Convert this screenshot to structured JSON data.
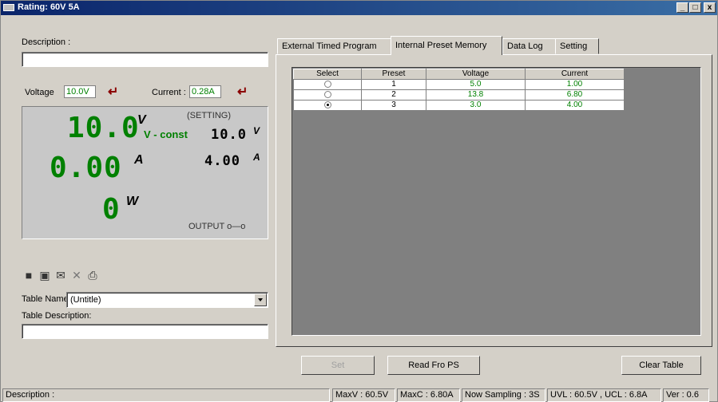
{
  "window": {
    "title": "Rating: 60V 5A",
    "minimize": "_",
    "maximize": "□",
    "close": "x"
  },
  "left": {
    "description_label": "Description :",
    "description_value": "",
    "voltage_label": "Voltage",
    "voltage_value": "10.0V",
    "current_label": "Current :",
    "current_value": "0.28A",
    "enter_glyph": "↵",
    "display": {
      "voltage_reading": "10.0",
      "voltage_unit": "V",
      "current_reading": "0.00",
      "current_unit": "A",
      "power_reading": "0",
      "power_unit": "W",
      "setting_label": "(SETTING)",
      "mode": "V - const",
      "set_voltage": "10.0",
      "set_voltage_unit": "V",
      "set_current": "4.00",
      "set_current_unit": "A",
      "output_label": "OUTPUT o—o"
    },
    "table_name_label": "Table Name:",
    "table_name_value": "(Untitle)",
    "table_description_label": "Table Description:",
    "table_description_value": ""
  },
  "tabs": [
    {
      "label": "External Timed Program"
    },
    {
      "label": "Internal Preset Memory"
    },
    {
      "label": "Data Log"
    },
    {
      "label": "Setting"
    }
  ],
  "preset_table": {
    "headers": [
      "Select",
      "Preset",
      "Voltage",
      "Current"
    ],
    "rows": [
      {
        "selected": false,
        "preset": "1",
        "voltage": "5.0",
        "current": "1.00"
      },
      {
        "selected": false,
        "preset": "2",
        "voltage": "13.8",
        "current": "6.80"
      },
      {
        "selected": true,
        "preset": "3",
        "voltage": "3.0",
        "current": "4.00"
      }
    ]
  },
  "buttons": {
    "set": "Set",
    "read": "Read Fro PS",
    "clear": "Clear Table"
  },
  "statusbar": {
    "description": "Description :",
    "maxv": "MaxV : 60.5V",
    "maxc": "MaxC : 6.80A",
    "sampling": "Now Sampling : 3S",
    "uvl": "UVL : 60.5V , UCL : 6.8A",
    "ver": "Ver : 0.6"
  },
  "colors": {
    "titlebar": "#0a246a",
    "readout_green": "#008000",
    "enter_arrow": "#8b0000"
  },
  "icons": [
    "new-file-icon",
    "save-icon",
    "open-folder-icon",
    "delete-icon",
    "print-icon"
  ]
}
